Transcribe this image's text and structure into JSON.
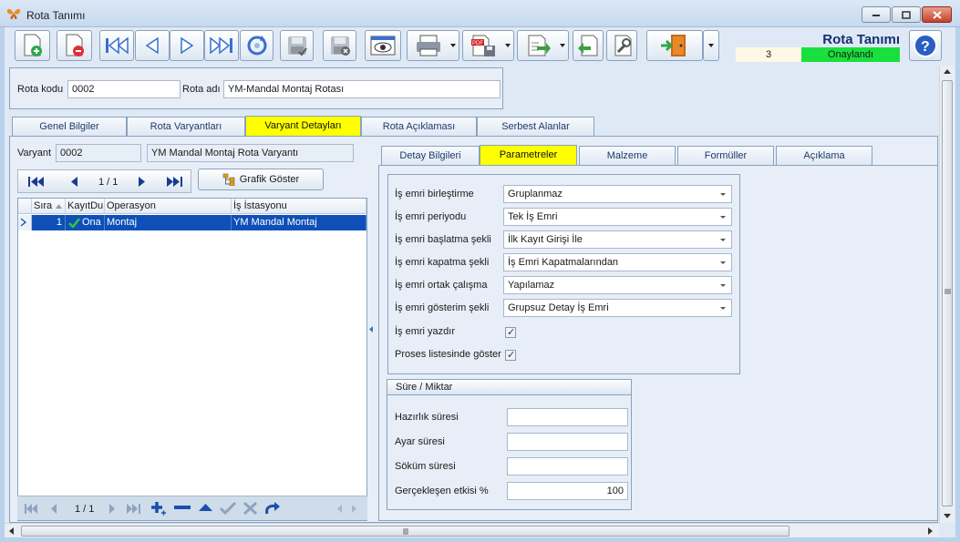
{
  "window": {
    "title": "Rota Tanımı"
  },
  "header": {
    "page_title": "Rota Tanımı",
    "record_no": "3",
    "status": "Onaylandı",
    "status_color": "#19e03c"
  },
  "toolbar": {
    "icons": [
      "new-document-icon",
      "delete-document-icon",
      "first-record-icon",
      "previous-record-icon",
      "next-record-icon",
      "last-record-icon",
      "refresh-icon",
      "save-icon",
      "save-cancel-icon",
      "preview-icon",
      "print-icon",
      "pdf-export-icon",
      "export-icon",
      "import-icon",
      "tools-icon",
      "exit-icon"
    ]
  },
  "route": {
    "code_label": "Rota kodu",
    "code_value": "0002",
    "name_label": "Rota adı",
    "name_value": "YM-Mandal Montaj Rotası"
  },
  "main_tabs": [
    "Genel Bilgiler",
    "Rota Varyantları",
    "Varyant Detayları",
    "Rota Açıklaması",
    "Serbest Alanlar"
  ],
  "variant": {
    "label": "Varyant",
    "code": "0002",
    "name": "YM Mandal Montaj Rota Varyantı"
  },
  "grid_nav": {
    "page": "1 / 1",
    "graph_button": "Grafik Göster"
  },
  "grid": {
    "columns": [
      "Sıra",
      "KayıtDu",
      "Operasyon",
      "İş İstasyonu"
    ],
    "rows": [
      {
        "sira": "1",
        "status": "Ona",
        "operation": "Montaj",
        "station": "YM Mandal Montaj"
      }
    ],
    "bottom_page": "1 / 1"
  },
  "detail_tabs": [
    "Detay Bilgileri",
    "Parametreler",
    "Malzeme",
    "Formüller",
    "Açıklama"
  ],
  "params": {
    "rows": [
      {
        "label": "İş emri birleştirme",
        "value": "Gruplanmaz"
      },
      {
        "label": "İş emri periyodu",
        "value": "Tek İş Emri"
      },
      {
        "label": "İş emri başlatma şekli",
        "value": "İlk Kayıt Girişi İle"
      },
      {
        "label": "İş emri kapatma şekli",
        "value": "İş Emri Kapatmalarından"
      },
      {
        "label": "İş emri ortak çalışma",
        "value": "Yapılamaz"
      },
      {
        "label": "İş emri gösterim şekli",
        "value": "Grupsuz Detay İş Emri"
      }
    ],
    "print_label": "İş emri yazdır",
    "show_in_process_label": "Proses listesinde göster"
  },
  "duration": {
    "title": "Süre / Miktar",
    "setup_label": "Hazırlık süresi",
    "setup_value": "",
    "adjust_label": "Ayar süresi",
    "adjust_value": "",
    "teardown_label": "Söküm süresi",
    "teardown_value": "",
    "efficiency_label": "Gerçekleşen etkisi %",
    "efficiency_value": "100"
  }
}
